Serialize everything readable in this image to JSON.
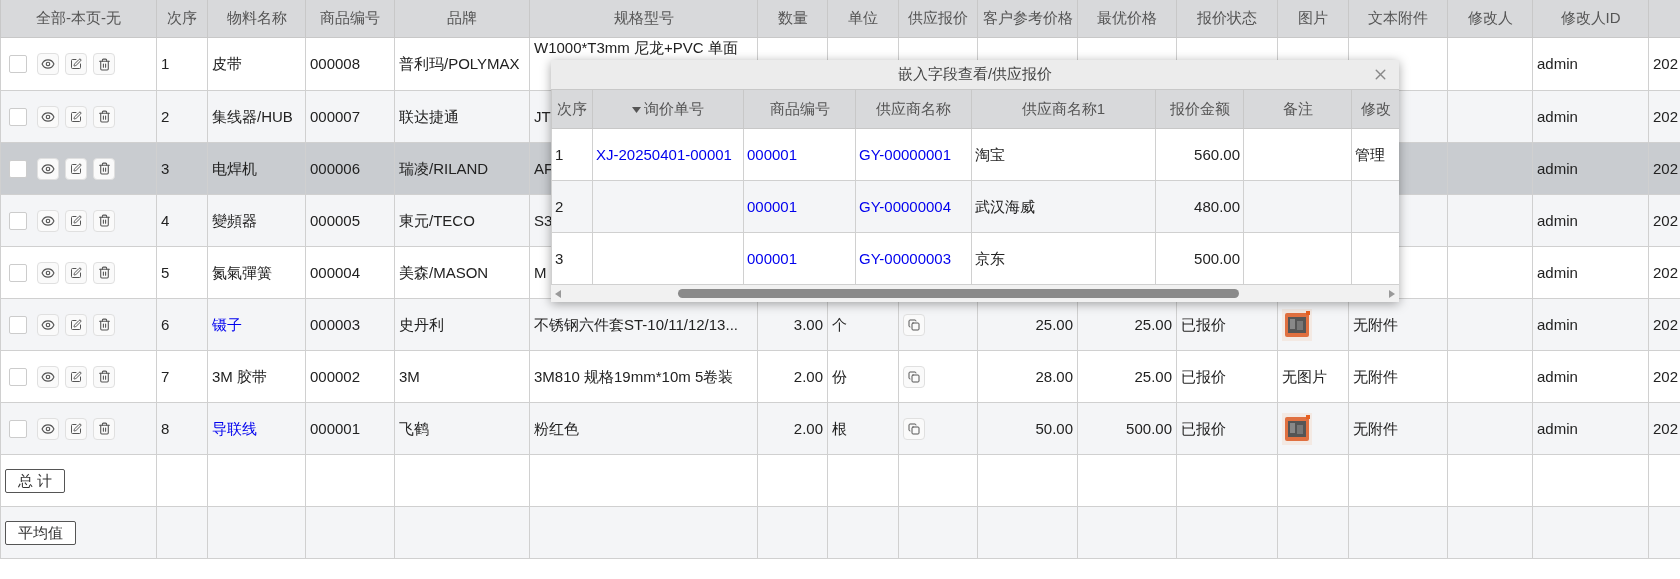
{
  "table": {
    "select_header": "全部-本页-无",
    "columns": [
      "次序",
      "物料名称",
      "商品编号",
      "品牌",
      "规格型号",
      "数量",
      "单位",
      "供应报价",
      "客户参考价格",
      "最优价格",
      "报价状态",
      "图片",
      "文本附件",
      "修改人",
      "修改人ID"
    ],
    "rows": [
      {
        "selected": false,
        "checked": false,
        "no": "1",
        "name": "皮带",
        "name_link": false,
        "code": "000008",
        "brand": "普利玛/POLYMAX",
        "spec": "W1000*T3mm 尼龙+PVC 单面",
        "modifier_id": "admin",
        "last": "202"
      },
      {
        "selected": false,
        "checked": false,
        "no": "2",
        "name": "集线器/HUB",
        "name_link": false,
        "code": "000007",
        "brand": "联达捷通",
        "spec": "JT",
        "modifier_id": "admin",
        "last": "202"
      },
      {
        "selected": true,
        "checked": false,
        "no": "3",
        "name": "电焊机",
        "name_link": false,
        "code": "000006",
        "brand": "瑞凌/RILAND",
        "spec": "AF",
        "modifier_id": "admin",
        "last": "202"
      },
      {
        "selected": false,
        "checked": false,
        "no": "4",
        "name": "變頻器",
        "name_link": false,
        "code": "000005",
        "brand": "東元/TECO",
        "spec": "S3",
        "modifier_id": "admin",
        "last": "202"
      },
      {
        "selected": false,
        "checked": false,
        "no": "5",
        "name": "氮氣彈簧",
        "name_link": false,
        "code": "000004",
        "brand": "美森/MASON",
        "spec": "M",
        "modifier_id": "admin",
        "last": "202"
      },
      {
        "selected": false,
        "checked": false,
        "no": "6",
        "name": "镊子",
        "name_link": true,
        "code": "000003",
        "brand": "史丹利",
        "spec": "不锈钢六件套ST-10/11/12/13...",
        "qty": "3.00",
        "unit": "个",
        "has_quote": true,
        "ref_price": "25.00",
        "best_price": "25.00",
        "status": "已报价",
        "attachment": "无附件",
        "modifier_id": "admin",
        "last": "202"
      },
      {
        "selected": false,
        "checked": false,
        "no": "7",
        "name": "3M 胶带",
        "name_link": false,
        "code": "000002",
        "brand": "3M",
        "spec": "3M810 规格19mm*10m 5卷装",
        "qty": "2.00",
        "unit": "份",
        "has_quote": true,
        "ref_price": "28.00",
        "best_price": "25.00",
        "status": "已报价",
        "image": {
          "kind": "text",
          "text": "无图片"
        },
        "attachment": "无附件",
        "modifier_id": "admin",
        "last": "202"
      },
      {
        "selected": false,
        "checked": false,
        "no": "8",
        "name": "导联线",
        "name_link": true,
        "code": "000001",
        "brand": "飞鹤",
        "spec": "粉红色",
        "qty": "2.00",
        "unit": "根",
        "has_quote": true,
        "ref_price": "50.00",
        "best_price": "500.00",
        "status": "已报价",
        "attachment": "无附件",
        "modifier_id": "admin",
        "last": "202"
      }
    ],
    "footer_buttons": [
      "总 计",
      "平均值"
    ]
  },
  "popup": {
    "title": "嵌入字段查看/供应报价",
    "columns": [
      "次序",
      "询价单号",
      "商品编号",
      "供应商名称",
      "供应商名称1",
      "报价金额",
      "备注",
      "修改"
    ],
    "rows": [
      {
        "no": "1",
        "inquiry": "XJ-20250401-00001",
        "code": "000001",
        "supplier": "GY-00000001",
        "supplier_name": "淘宝",
        "amount": "560.00",
        "modifier": "管理"
      },
      {
        "no": "2",
        "code": "000001",
        "supplier": "GY-00000004",
        "supplier_name": "武汉海威",
        "amount": "480.00"
      },
      {
        "no": "3",
        "code": "000001",
        "supplier": "GY-00000003",
        "supplier_name": "京东",
        "amount": "500.00"
      }
    ]
  }
}
